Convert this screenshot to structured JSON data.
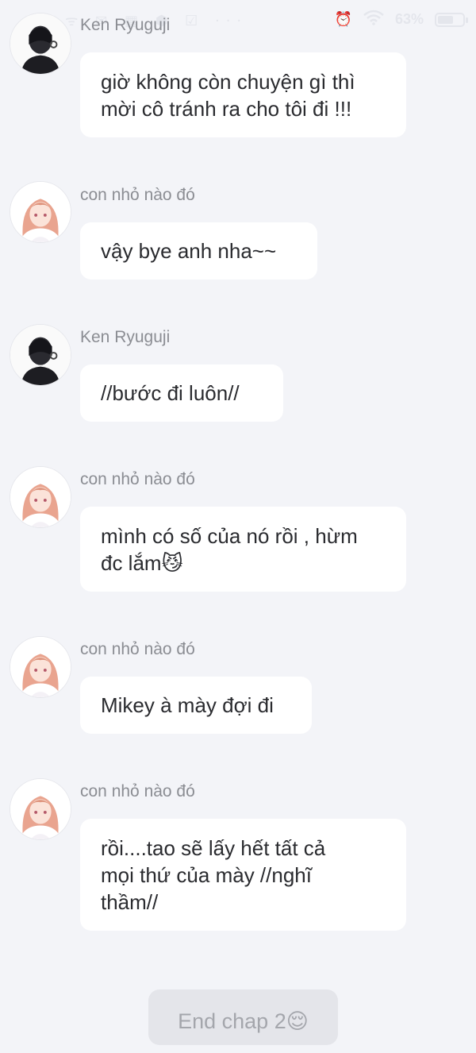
{
  "status_bar": {
    "left_glyphs": "ᯤ ✉ ▦ ⬢ ☑ ···",
    "battery_percent": "63%",
    "battery_level": 0.63
  },
  "messages": [
    {
      "sender": "Ken Ryuguji",
      "text": "giờ không còn chuyện gì thì\nmời cô tránh ra cho tôi đi !!!",
      "avatar": "ken-avatar"
    },
    {
      "sender": "con nhỏ nào đó",
      "text": "vậy bye anh nha~~",
      "avatar": "girl-avatar"
    },
    {
      "sender": "Ken Ryuguji",
      "text": "//bước đi luôn//",
      "avatar": "ken-avatar"
    },
    {
      "sender": "con nhỏ nào đó",
      "text": "mình có số của nó rồi , hừm\nđc lắm😼",
      "avatar": "girl-avatar"
    },
    {
      "sender": "con nhỏ nào đó",
      "text": "Mikey à mày đợi đi",
      "avatar": "girl-avatar"
    },
    {
      "sender": "con nhỏ nào đó",
      "text": "rồi....tao sẽ lấy hết tất cả\nmọi thứ của mày //nghĩ\nthầm//",
      "avatar": "girl-avatar"
    }
  ],
  "end_label": "End chap 2😌",
  "colors": {
    "background": "#f3f4f8",
    "bubble": "#ffffff",
    "sender_text": "#8b8d93",
    "pill": "#e4e5ea"
  }
}
